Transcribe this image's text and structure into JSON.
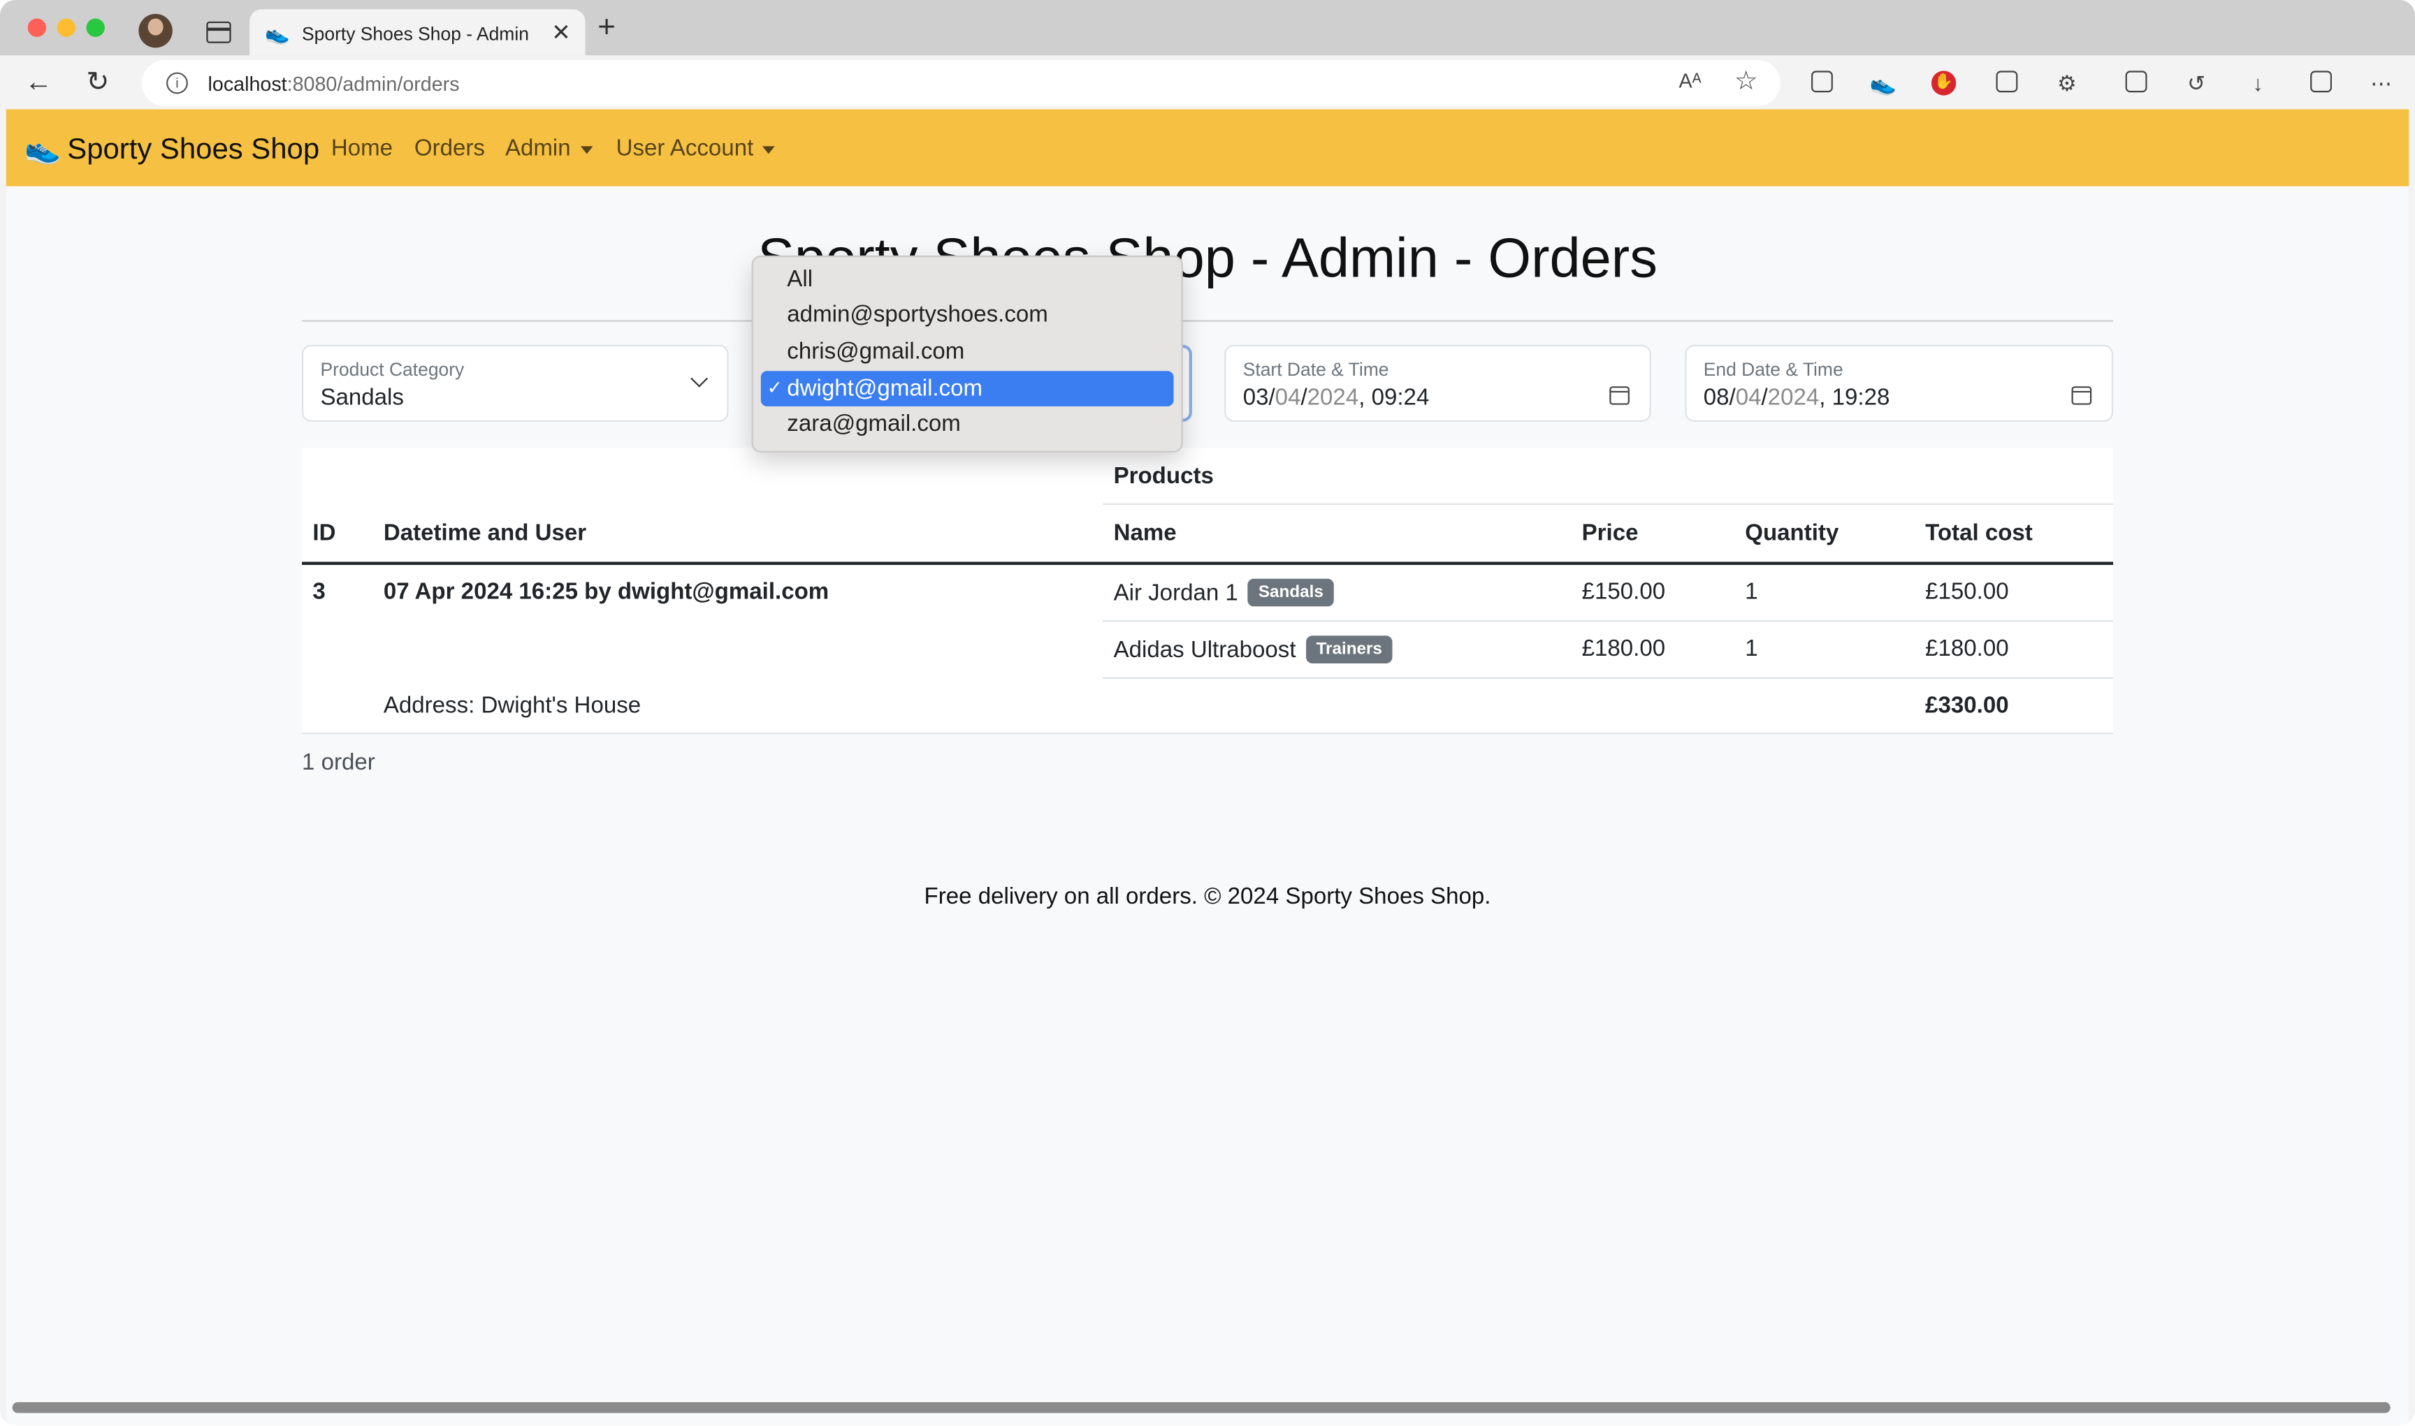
{
  "browser": {
    "tab_title": "Sporty Shoes Shop - Admin - Orders",
    "url_host": "localhost",
    "url_rest": ":8080/admin/orders",
    "read_aloud": "Aᴬ"
  },
  "navbar": {
    "brand": "Sporty Shoes Shop",
    "links": [
      "Home",
      "Orders",
      "Admin",
      "User Account"
    ]
  },
  "page": {
    "title": "Sporty Shoes Shop - Admin - Orders"
  },
  "filters": {
    "category": {
      "label": "Product Category",
      "value": "Sandals"
    },
    "start": {
      "label": "Start Date & Time",
      "day": "03",
      "month": "04",
      "year": "2024",
      "time": ", 09:24"
    },
    "end": {
      "label": "End Date & Time",
      "day": "08",
      "month": "04",
      "year": "2024",
      "time": ", 19:28"
    }
  },
  "user_dropdown": {
    "options": [
      "All",
      "admin@sportyshoes.com",
      "chris@gmail.com",
      "dwight@gmail.com",
      "zara@gmail.com"
    ],
    "selected_index": 3
  },
  "table": {
    "group_header": "Products",
    "columns": [
      "ID",
      "Datetime and User",
      "Name",
      "Price",
      "Quantity",
      "Total cost"
    ],
    "order": {
      "id": "3",
      "datetime_user": "07 Apr 2024 16:25 by dwight@gmail.com",
      "address": "Address: Dwight's House",
      "total": "£330.00",
      "items": [
        {
          "name": "Air Jordan 1",
          "badge": "Sandals",
          "price": "£150.00",
          "qty": "1",
          "total": "£150.00"
        },
        {
          "name": "Adidas Ultraboost",
          "badge": "Trainers",
          "price": "£180.00",
          "qty": "1",
          "total": "£180.00"
        }
      ]
    }
  },
  "summary": {
    "count": "1 order"
  },
  "footer": {
    "text": "Free delivery on all orders. © 2024 Sporty Shoes Shop."
  }
}
